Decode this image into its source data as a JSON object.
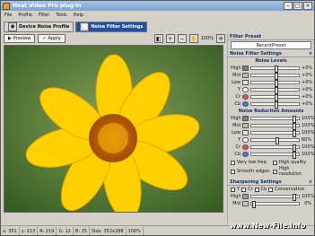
{
  "window": {
    "title": "Heat Video Pro plug-in"
  },
  "menu": [
    "File",
    "Profile",
    "Filter",
    "Tools",
    "Help"
  ],
  "tabs": [
    {
      "label": "Device Noise Profile"
    },
    {
      "label": "Noise Filter Settings"
    }
  ],
  "toolbar": {
    "preview_label": "Preview",
    "apply_label": "Apply",
    "zoom": "100%"
  },
  "filter_preset": {
    "title": "Filter Preset",
    "value": "RecentPreset"
  },
  "noise_filter": {
    "title": "Noise Filter Settings",
    "levels_title": "Noise Levels",
    "levels": [
      {
        "label": "High",
        "value": "+0%",
        "pos": 0.52
      },
      {
        "label": "Mid",
        "value": "+0%",
        "pos": 0.52
      },
      {
        "label": "Low",
        "value": "+0%",
        "pos": 0.52
      },
      {
        "label": "Y",
        "value": "+0%",
        "pos": 0.52
      },
      {
        "label": "Cr",
        "value": "+0%",
        "pos": 0.52
      },
      {
        "label": "Cb",
        "value": "+0%",
        "pos": 0.52
      }
    ],
    "amounts_title": "Noise Reduction Amounts",
    "amounts": [
      {
        "label": "High",
        "value": "100%",
        "pos": 0.9
      },
      {
        "label": "Mid",
        "value": "100%",
        "pos": 0.9
      },
      {
        "label": "Low",
        "value": "100%",
        "pos": 0.9
      },
      {
        "label": "Y",
        "value": "60%",
        "pos": 0.55
      },
      {
        "label": "Cr",
        "value": "100%",
        "pos": 0.9
      },
      {
        "label": "Cb",
        "value": "100%",
        "pos": 0.9
      }
    ],
    "options": [
      {
        "label": "Very low freq",
        "checked": false
      },
      {
        "label": "High quality",
        "checked": true
      },
      {
        "label": "Smooth edges",
        "checked": false
      },
      {
        "label": "High resolution",
        "checked": true
      }
    ]
  },
  "sharpening": {
    "title": "Sharpening Settings",
    "channels": [
      "Y",
      "Cr",
      "Cb",
      "Conservative"
    ],
    "rows": [
      {
        "label": "High",
        "value": "100%",
        "pos": 0.9
      },
      {
        "label": "Mid",
        "value": "0%",
        "pos": 0.05
      }
    ]
  },
  "status": {
    "x": "x: 351",
    "y": "y: 213",
    "r": "R: 219",
    "g": "G: 12",
    "b": "B: 25",
    "size": "Size: 352x288",
    "zoom": "100%"
  },
  "watermark": "www.New-File.info",
  "colors": {
    "accent": "#1f52a3",
    "panel": "#d4d0c8"
  }
}
